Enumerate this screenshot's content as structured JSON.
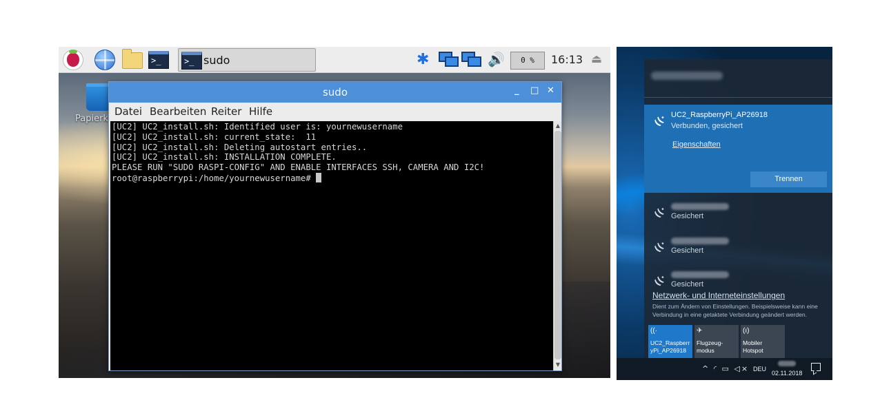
{
  "rpi": {
    "taskbar": {
      "task_label": "sudo",
      "term_glyph": ">_",
      "cpu_usage": "0 %",
      "clock": "16:13",
      "bluetooth_glyph": "✱"
    },
    "desktop_label": "Papierk",
    "terminal": {
      "title": "sudo",
      "menu": [
        "Datei",
        "Bearbeiten",
        "Reiter",
        "Hilfe"
      ],
      "lines": [
        "[UC2] UC2_install.sh: Identified user is: yournewusername",
        "[UC2] UC2_install.sh: current_state:  11",
        "[UC2] UC2_install.sh: Deleting autostart entries..",
        "[UC2] UC2_install.sh: INSTALLATION COMPLETE.",
        "PLEASE RUN \"SUDO RASPI-CONFIG\" AND ENABLE INTERFACES SSH, CAMERA AND I2C!",
        "root@raspberrypi:/home/yournewusername# "
      ],
      "window_buttons": {
        "minimize": "_",
        "maximize": "□",
        "close": "✕"
      }
    }
  },
  "win10": {
    "connected": {
      "ssid": "UC2_RaspberryPi_AP26918",
      "status": "Verbunden, gesichert",
      "properties_link": "Eigenschaften",
      "disconnect_label": "Trennen"
    },
    "networks": [
      {
        "security": "Gesichert"
      },
      {
        "security": "Gesichert"
      },
      {
        "security": "Gesichert"
      }
    ],
    "settings_link": "Netzwerk- und Interneteinstellungen",
    "settings_desc": "Dient zum Ändern von Einstellungen. Beispielsweise kann eine Verbindung in eine getaktete Verbindung geändert werden.",
    "quick_actions": [
      {
        "icon": "wifi-icon",
        "glyph": "((·",
        "label": "UC2_Raspberr yPi_AP26918"
      },
      {
        "icon": "airplane-icon",
        "glyph": "✈",
        "label": "Flugzeug- modus"
      },
      {
        "icon": "hotspot-icon",
        "glyph": "(ı)",
        "label": "Mobiler Hotspot"
      }
    ],
    "taskbar": {
      "tray_glyphs": "^ ◜ ▭ ◁×",
      "language": "DEU",
      "date": "02.11.2018"
    }
  },
  "colors": {
    "rpi_title_bar": "#4d8fd9",
    "win_accent": "#1f6fb5",
    "win_flyout": "#1c2836"
  }
}
